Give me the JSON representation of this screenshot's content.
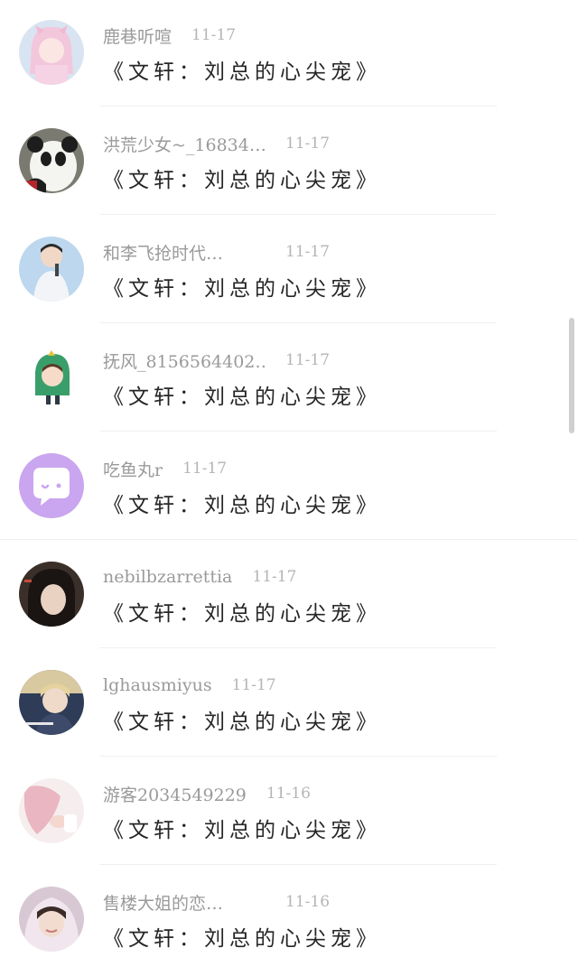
{
  "comments": [
    {
      "username": "鹿巷听喧",
      "date": "11-17",
      "content": "《文轩：刘总的心尖宠》",
      "avatar": "anime-girl-avatar"
    },
    {
      "username": "洪荒少女~_16834…",
      "date": "11-17",
      "content": "《文轩：刘总的心尖宠》",
      "avatar": "panda-avatar"
    },
    {
      "username": "和李飞抢时代…",
      "date": "11-17",
      "content": "《文轩：刘总的心尖宠》",
      "avatar": "singer-avatar"
    },
    {
      "username": "抚风_8156564402…",
      "date": "11-17",
      "content": "《文轩：刘总的心尖宠》",
      "avatar": "dinosaur-costume-avatar"
    },
    {
      "username": "吃鱼丸r",
      "date": "11-17",
      "content": "《文轩：刘总的心尖宠》",
      "avatar": "chat-bubble-avatar"
    },
    {
      "username": "nebilbzarrettia",
      "date": "11-17",
      "content": "《文轩：刘总的心尖宠》",
      "avatar": "child-portrait-avatar"
    },
    {
      "username": "lghausmiyus",
      "date": "11-17",
      "content": "《文轩：刘总的心尖宠》",
      "avatar": "boy-portrait-avatar"
    },
    {
      "username": "游客2034549229",
      "date": "11-16",
      "content": "《文轩：刘总的心尖宠》",
      "avatar": "pink-hair-avatar"
    },
    {
      "username": "售楼大姐的恋…",
      "date": "11-16",
      "content": "《文轩：刘总的心尖宠》",
      "avatar": "hooded-girl-avatar"
    }
  ],
  "colors": {
    "username": "#9a9a9a",
    "date": "#b5b5b5",
    "content": "#262626",
    "divider": "#f0f0f0",
    "chat_avatar": "#c9a6ef"
  }
}
